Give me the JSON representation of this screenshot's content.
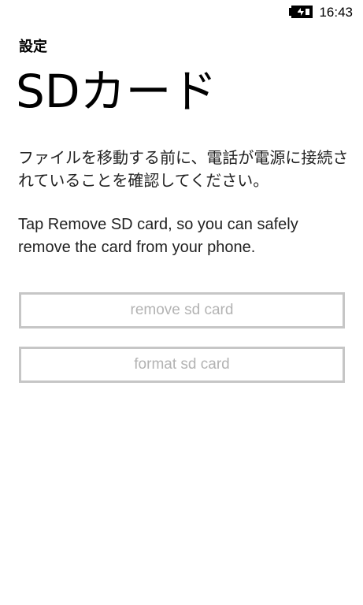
{
  "status_bar": {
    "battery_icon": "battery-charging-icon",
    "time": "16:43"
  },
  "header": {
    "app_title": "設定",
    "page_title": "SDカード"
  },
  "content": {
    "warning": "ファイルを移動する前に、電話が電源に接続されていることを確認してください。",
    "instruction": "Tap Remove SD card, so you can safely remove the card from your phone."
  },
  "buttons": {
    "remove_label": "remove sd card",
    "format_label": "format sd card"
  },
  "colors": {
    "background": "#ffffff",
    "text": "#000000",
    "button_border": "#c6c6c6",
    "button_text_disabled": "#b3b3b3"
  }
}
